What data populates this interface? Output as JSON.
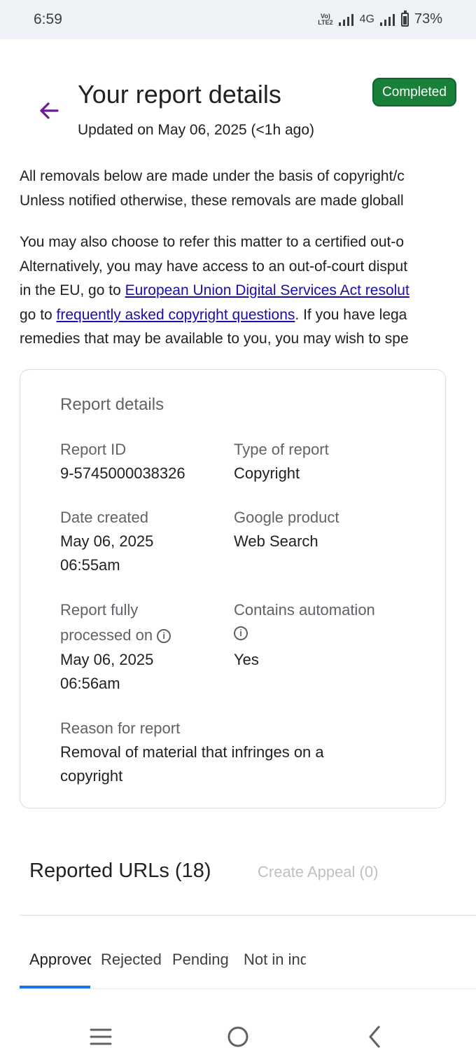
{
  "status_bar": {
    "time": "6:59",
    "network": "4G",
    "volte": "Vo) LTE2",
    "battery": "73%"
  },
  "header": {
    "title": "Your report details",
    "updated": "Updated on May 06, 2025 (<1h ago)",
    "status_badge": "Completed"
  },
  "intro": {
    "p1_line1": "All removals below are made under the basis of copyright/c",
    "p1_line2": "Unless notified otherwise, these removals are made globall",
    "p2_line1": "You may also choose to refer this matter to a certified out-o",
    "p2_line2": "Alternatively, you may have access to an out-of-court disput",
    "p2_line3_pre": "in the EU, go to ",
    "p2_line3_link": "European Union Digital Services Act resolut",
    "p2_line4_pre": "go to ",
    "p2_line4_link": "frequently asked copyright questions",
    "p2_line4_post": ". If you have lega",
    "p2_line5": "remedies that may be available to you, you may wish to spe"
  },
  "report_details": {
    "title": "Report details",
    "report_id_label": "Report ID",
    "report_id_value": "9-5745000038326",
    "type_label": "Type of report",
    "type_value": "Copyright",
    "date_created_label": "Date created",
    "date_created_date": "May 06, 2025",
    "date_created_time": "06:55am",
    "product_label": "Google product",
    "product_value": "Web Search",
    "processed_label_line1": "Report fully",
    "processed_label_line2": "processed on",
    "processed_date": "May 06, 2025",
    "processed_time": "06:56am",
    "automation_label": "Contains automation",
    "automation_value": "Yes",
    "reason_label": "Reason for report",
    "reason_line1": "Removal of material that infringes on a",
    "reason_line2": "copyright",
    "info_glyph": "i"
  },
  "urls": {
    "title": "Reported URLs (18)",
    "appeal_label": "Create Appeal (0)",
    "tabs": [
      {
        "label": "Approved"
      },
      {
        "label": "Rejected"
      },
      {
        "label": "Pending"
      },
      {
        "label": "Not in index"
      }
    ]
  },
  "icons": {
    "back": "arrow-left-icon",
    "nav": [
      "recent-apps-icon",
      "home-icon",
      "back-nav-icon"
    ]
  },
  "colors": {
    "accent": "#1a73e8",
    "badge_green": "#188038",
    "link": "#1a0dab",
    "back_arrow": "#6a1b9a"
  }
}
